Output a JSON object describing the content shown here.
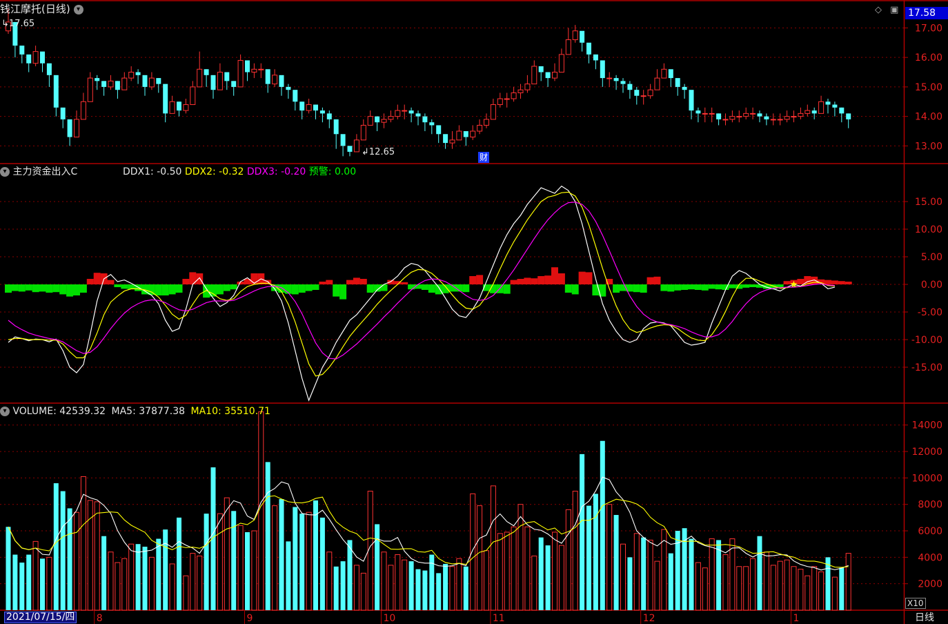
{
  "title": "钱江摩托(日线)",
  "current_price": "17.58",
  "period_label": "日线",
  "date_label": "2021/07/15/四",
  "x10_label": "X10",
  "financial_marker": "财",
  "price_high_label": "17.65",
  "price_low_label": "12.65",
  "indicator": {
    "name": "主力资金出入C",
    "ddx1_label": "DDX1:",
    "ddx1_value": "-0.50",
    "ddx2_label": "DDX2:",
    "ddx2_value": "-0.32",
    "ddx3_label": "DDX3:",
    "ddx3_value": "-0.20",
    "warn_label": "预警:",
    "warn_value": "0.00"
  },
  "volume_panel": {
    "volume_label": "VOLUME:",
    "volume_value": "42539.32",
    "ma5_label": "MA5:",
    "ma5_value": "37877.38",
    "ma10_label": "MA10:",
    "ma10_value": "35510.71"
  },
  "colors": {
    "up": "#ff3232",
    "down": "#54ffff",
    "ddx1": "#ffffff",
    "ddx2": "#ffff00",
    "ddx3": "#ff00ff",
    "grid": "#8b0000"
  },
  "chart_data": [
    {
      "type": "candlestick",
      "title": "钱江摩托(日线)",
      "y_ticks": [
        13.0,
        14.0,
        15.0,
        16.0,
        17.0
      ],
      "y_tick_labels": [
        "13.00",
        "14.00",
        "15.00",
        "16.00",
        "17.00"
      ],
      "ylim": [
        12.4,
        17.9
      ],
      "x_ticks": [
        {
          "label": "8",
          "index": 13
        },
        {
          "label": "9",
          "index": 35
        },
        {
          "label": "10",
          "index": 55
        },
        {
          "label": "11",
          "index": 71
        },
        {
          "label": "12",
          "index": 93
        },
        {
          "label": "1",
          "index": 115
        }
      ],
      "annotations": [
        {
          "text": "17.65",
          "index": 0
        },
        {
          "text": "12.65",
          "index": 53
        },
        {
          "text": "财",
          "index": 70
        }
      ],
      "close": [
        17.2,
        16.4,
        16.1,
        15.8,
        16.2,
        15.8,
        15.4,
        14.3,
        13.9,
        13.3,
        13.9,
        14.5,
        15.3,
        15.2,
        15.0,
        15.2,
        14.9,
        15.3,
        15.5,
        15.4,
        15.0,
        15.3,
        15.1,
        14.1,
        14.5,
        14.2,
        14.4,
        15.0,
        15.6,
        15.4,
        14.9,
        15.5,
        15.2,
        15.0,
        15.9,
        15.5,
        15.6,
        15.6,
        15.1,
        15.4,
        15.0,
        14.9,
        14.5,
        14.2,
        14.4,
        14.2,
        14.1,
        13.9,
        13.4,
        13.0,
        12.8,
        13.2,
        13.7,
        14.0,
        13.8,
        13.9,
        14.0,
        14.2,
        14.2,
        14.1,
        14.0,
        13.8,
        13.7,
        13.4,
        13.1,
        13.2,
        13.5,
        13.3,
        13.5,
        13.7,
        13.9,
        14.4,
        14.6,
        14.6,
        14.8,
        14.9,
        15.1,
        15.7,
        15.5,
        15.3,
        15.5,
        16.1,
        16.6,
        16.9,
        16.5,
        16.1,
        15.9,
        15.3,
        15.3,
        15.2,
        15.1,
        14.9,
        14.7,
        14.7,
        14.9,
        15.3,
        15.6,
        15.3,
        15.0,
        14.9,
        14.2,
        14.1,
        14.1,
        14.1,
        13.9,
        13.9,
        14.0,
        14.0,
        14.1,
        14.1,
        14.0,
        13.9,
        13.9,
        13.9,
        14.0,
        14.0,
        14.1,
        14.2,
        14.1,
        14.5,
        14.4,
        14.3,
        14.1,
        13.9
      ],
      "high": [
        17.65,
        16.6,
        16.3,
        16.0,
        16.4,
        16.0,
        15.6,
        14.6,
        14.2,
        13.6,
        14.2,
        14.8,
        15.5,
        15.4,
        15.2,
        15.4,
        15.2,
        15.5,
        15.7,
        15.6,
        15.2,
        15.5,
        15.3,
        14.4,
        14.7,
        14.5,
        14.6,
        15.2,
        16.2,
        15.6,
        15.1,
        15.8,
        15.4,
        15.2,
        16.1,
        15.8,
        15.8,
        15.8,
        15.3,
        15.6,
        15.2,
        15.1,
        14.8,
        14.5,
        14.6,
        14.4,
        14.3,
        14.2,
        13.7,
        13.2,
        13.0,
        13.4,
        13.9,
        14.2,
        14.0,
        14.1,
        14.2,
        14.4,
        14.4,
        14.3,
        14.2,
        14.1,
        13.9,
        13.7,
        13.3,
        13.5,
        13.7,
        13.5,
        13.7,
        13.9,
        14.1,
        14.6,
        14.8,
        14.8,
        15.0,
        15.1,
        15.4,
        15.9,
        15.7,
        15.5,
        15.8,
        16.3,
        17.0,
        17.1,
        16.7,
        16.4,
        16.1,
        15.6,
        15.5,
        15.4,
        15.3,
        15.2,
        15.0,
        14.9,
        15.1,
        15.6,
        15.8,
        15.5,
        15.2,
        15.1,
        14.5,
        14.3,
        14.3,
        14.3,
        14.1,
        14.1,
        14.2,
        14.2,
        14.3,
        14.3,
        14.2,
        14.1,
        14.1,
        14.1,
        14.2,
        14.2,
        14.3,
        14.4,
        14.3,
        14.7,
        14.6,
        14.5,
        14.3,
        14.1
      ],
      "low": [
        16.8,
        16.0,
        15.8,
        15.5,
        15.7,
        15.5,
        15.0,
        14.0,
        13.6,
        13.0,
        13.5,
        14.1,
        14.9,
        14.9,
        14.7,
        14.9,
        14.6,
        14.9,
        15.2,
        15.1,
        14.7,
        14.9,
        14.8,
        13.8,
        14.1,
        14.0,
        14.1,
        14.6,
        15.1,
        15.0,
        14.6,
        15.1,
        14.9,
        14.7,
        15.4,
        15.2,
        15.3,
        15.3,
        14.8,
        15.0,
        14.7,
        14.6,
        14.2,
        13.9,
        14.1,
        13.9,
        13.8,
        13.6,
        12.9,
        12.65,
        12.65,
        12.9,
        13.4,
        13.7,
        13.5,
        13.6,
        13.8,
        13.9,
        13.9,
        13.8,
        13.7,
        13.5,
        13.4,
        13.1,
        12.9,
        12.9,
        13.2,
        13.0,
        13.2,
        13.4,
        13.6,
        14.1,
        14.3,
        14.3,
        14.5,
        14.6,
        14.8,
        15.3,
        15.2,
        15.0,
        15.2,
        15.7,
        16.2,
        16.5,
        16.2,
        15.8,
        15.6,
        15.0,
        15.0,
        14.9,
        14.8,
        14.6,
        14.4,
        14.4,
        14.6,
        15.0,
        15.3,
        15.0,
        14.7,
        14.6,
        13.9,
        13.8,
        13.8,
        13.8,
        13.7,
        13.7,
        13.8,
        13.8,
        13.9,
        13.9,
        13.8,
        13.7,
        13.7,
        13.7,
        13.8,
        13.8,
        13.9,
        14.0,
        13.9,
        14.2,
        14.1,
        14.0,
        13.8,
        13.6
      ]
    },
    {
      "type": "line",
      "title": "主力资金出入C",
      "y_ticks": [
        -15,
        -10,
        -5,
        0,
        5,
        10,
        15
      ],
      "y_tick_labels": [
        "-15.00",
        "-10.00",
        "-5.00",
        "0.00",
        "5.00",
        "10.00",
        "15.00"
      ],
      "ylim": [
        -21.5,
        21.5
      ],
      "series": [
        {
          "name": "DDX1",
          "values": [
            -10.5,
            -9.5,
            -9.8,
            -10.2,
            -9.9,
            -10.0,
            -10.4,
            -9.9,
            -12.0,
            -15.0,
            -16.0,
            -14.5,
            -9.0,
            -3.0,
            1.0,
            1.8,
            0.5,
            0.8,
            0.2,
            -0.5,
            -1.2,
            -2.0,
            -3.5,
            -6.5,
            -8.5,
            -8.0,
            -4.5,
            0.0,
            1.2,
            -0.8,
            -2.5,
            -4.0,
            -3.3,
            -2.0,
            0.5,
            1.2,
            0.2,
            1.0,
            0.5,
            -0.8,
            -3.0,
            -7.0,
            -12.0,
            -17.0,
            -21.0,
            -18.0,
            -15.0,
            -13.0,
            -10.5,
            -8.5,
            -6.5,
            -5.5,
            -4.0,
            -2.5,
            -1.0,
            0.0,
            0.5,
            1.5,
            3.0,
            3.8,
            3.5,
            2.5,
            1.0,
            -0.5,
            -2.5,
            -4.5,
            -5.7,
            -6.0,
            -4.5,
            -2.5,
            0.5,
            3.5,
            6.5,
            9.0,
            11.0,
            12.5,
            14.5,
            16.0,
            17.5,
            17.0,
            16.5,
            17.8,
            17.0,
            15.0,
            11.0,
            6.0,
            1.0,
            -3.5,
            -6.5,
            -8.5,
            -10.0,
            -10.5,
            -10.0,
            -8.0,
            -7.0,
            -6.8,
            -7.0,
            -7.5,
            -9.0,
            -10.5,
            -11.0,
            -10.8,
            -10.5,
            -7.0,
            -4.0,
            -1.0,
            1.5,
            2.5,
            2.0,
            1.0,
            0.0,
            -0.5,
            -0.8,
            -1.2,
            -0.5,
            0.0,
            -0.3,
            0.5,
            0.8,
            0.2,
            -0.8,
            -0.5
          ],
          "color": "#ffffff"
        },
        {
          "name": "DDX2",
          "values": [
            -10.0,
            -9.8,
            -9.8,
            -10.0,
            -10.0,
            -10.0,
            -10.1,
            -10.1,
            -10.8,
            -12.2,
            -13.3,
            -13.3,
            -11.7,
            -8.8,
            -5.5,
            -3.2,
            -2.1,
            -1.2,
            -0.8,
            -0.8,
            -1.0,
            -1.4,
            -2.3,
            -3.8,
            -5.4,
            -6.3,
            -5.6,
            -3.6,
            -1.8,
            -1.1,
            -1.7,
            -2.6,
            -2.9,
            -2.6,
            -1.3,
            -0.4,
            0.0,
            0.2,
            0.2,
            -0.2,
            -1.3,
            -3.6,
            -6.8,
            -10.6,
            -14.4,
            -16.6,
            -16.3,
            -15.0,
            -13.3,
            -11.3,
            -9.4,
            -7.9,
            -6.5,
            -5.1,
            -3.6,
            -2.3,
            -1.1,
            0.0,
            1.2,
            2.2,
            2.7,
            2.6,
            2.0,
            0.9,
            -0.4,
            -1.9,
            -3.3,
            -4.3,
            -4.5,
            -3.8,
            -2.2,
            0.1,
            2.8,
            5.4,
            7.7,
            9.7,
            11.7,
            13.4,
            15.0,
            15.8,
            16.1,
            16.6,
            16.7,
            16.0,
            14.0,
            10.8,
            6.9,
            2.9,
            -0.8,
            -3.9,
            -6.4,
            -8.1,
            -8.7,
            -8.4,
            -7.9,
            -7.5,
            -7.3,
            -7.4,
            -8.0,
            -8.9,
            -9.7,
            -10.1,
            -10.2,
            -9.1,
            -7.3,
            -4.9,
            -2.2,
            0.0,
            1.1,
            1.1,
            0.6,
            0.1,
            -0.3,
            -0.7,
            -0.6,
            -0.4,
            -0.4,
            0.1,
            0.4,
            0.3,
            -0.2,
            -0.3
          ],
          "color": "#ffff00"
        },
        {
          "name": "DDX3",
          "values": [
            -6.5,
            -7.5,
            -8.2,
            -8.8,
            -9.2,
            -9.5,
            -9.8,
            -10.0,
            -10.4,
            -11.2,
            -12.0,
            -12.5,
            -12.3,
            -11.3,
            -9.7,
            -8.0,
            -6.5,
            -5.2,
            -4.2,
            -3.5,
            -3.0,
            -2.8,
            -2.9,
            -3.3,
            -4.0,
            -4.6,
            -4.8,
            -4.5,
            -3.9,
            -3.3,
            -3.0,
            -3.0,
            -3.0,
            -2.9,
            -2.4,
            -1.8,
            -1.2,
            -0.7,
            -0.4,
            -0.3,
            -0.6,
            -1.5,
            -3.1,
            -5.3,
            -8.0,
            -10.6,
            -12.4,
            -13.4,
            -13.5,
            -12.8,
            -11.8,
            -10.8,
            -9.6,
            -8.4,
            -7.2,
            -5.9,
            -4.7,
            -3.4,
            -2.2,
            -1.0,
            0.0,
            0.7,
            1.0,
            0.9,
            0.5,
            -0.2,
            -1.1,
            -2.0,
            -2.7,
            -2.9,
            -2.7,
            -2.0,
            -0.7,
            0.9,
            2.6,
            4.5,
            6.4,
            8.3,
            10.1,
            11.7,
            13.0,
            14.1,
            14.8,
            14.9,
            14.5,
            13.3,
            11.4,
            8.9,
            6.1,
            3.2,
            0.4,
            -2.1,
            -4.0,
            -5.4,
            -6.3,
            -6.8,
            -7.1,
            -7.3,
            -7.6,
            -8.0,
            -8.6,
            -9.1,
            -9.5,
            -9.5,
            -9.1,
            -8.1,
            -6.7,
            -5.0,
            -3.5,
            -2.3,
            -1.5,
            -1.0,
            -0.7,
            -0.6,
            -0.5,
            -0.5,
            -0.4,
            -0.2,
            0.0,
            0.1,
            -0.1,
            -0.2
          ],
          "color": "#ff00ff"
        }
      ],
      "bars": [
        -1.5,
        -1.2,
        -1.3,
        -1.1,
        -1.4,
        -1.3,
        -1.5,
        -1.4,
        -1.8,
        -2.2,
        -2.0,
        -1.5,
        1.0,
        2.1,
        2.0,
        0.8,
        -0.5,
        -0.8,
        -0.9,
        -1.2,
        -1.8,
        -1.9,
        -2.0,
        -2.0,
        -1.8,
        -1.5,
        1.0,
        2.2,
        2.0,
        -2.4,
        -2.2,
        -1.8,
        -1.2,
        -0.9,
        0.5,
        1.0,
        2.0,
        2.0,
        0.8,
        -1.2,
        -1.5,
        -1.7,
        -1.8,
        -1.5,
        -1.2,
        -1.0,
        0.5,
        0.8,
        -2.2,
        -2.7,
        0.8,
        1.2,
        1.0,
        -1.5,
        -1.3,
        -1.2,
        0.8,
        0.6,
        0.4,
        -0.9,
        -0.8,
        -1.0,
        -1.5,
        -1.8,
        -1.6,
        -1.3,
        -1.3,
        -1.4,
        1.5,
        1.7,
        -1.2,
        -1.6,
        -1.6,
        -1.7,
        0.8,
        1.0,
        1.2,
        1.1,
        1.5,
        1.6,
        3.1,
        2.0,
        -1.5,
        -1.8,
        2.3,
        2.2,
        -2.0,
        -2.2,
        1.0,
        -1.5,
        -1.2,
        -1.3,
        -1.4,
        -1.5,
        1.3,
        1.4,
        -1.2,
        -1.3,
        -1.1,
        -1.0,
        -0.9,
        -1.0,
        -1.1,
        -0.8,
        -0.9,
        -1.0,
        -0.7,
        -0.8,
        -0.6,
        -0.5,
        -0.6,
        -0.8,
        -0.9,
        -0.7,
        0.6,
        0.8,
        1.0,
        1.5,
        1.4,
        0.9,
        0.8,
        0.7,
        0.6,
        0.5
      ],
      "marker": {
        "type": "star",
        "index": 115
      }
    },
    {
      "type": "bar",
      "title": "VOLUME",
      "y_ticks": [
        2000,
        4000,
        6000,
        8000,
        10000,
        12000,
        14000
      ],
      "y_tick_labels": [
        "2000",
        "4000",
        "6000",
        "8000",
        "10000",
        "12000",
        "14000"
      ],
      "ylim": [
        0,
        15500
      ],
      "values": [
        6300,
        4200,
        3600,
        4200,
        5200,
        3900,
        4000,
        9600,
        9000,
        7700,
        7400,
        10100,
        8300,
        8200,
        5600,
        4400,
        3600,
        3900,
        5000,
        5000,
        4800,
        4000,
        5400,
        6100,
        3500,
        7000,
        2600,
        4300,
        4100,
        7300,
        10800,
        7300,
        8500,
        7500,
        6400,
        5900,
        6000,
        15000,
        11200,
        7900,
        8400,
        5200,
        7800,
        7300,
        7400,
        8300,
        7000,
        4400,
        3300,
        3700,
        5300,
        3400,
        2800,
        9000,
        6500,
        4400,
        3400,
        4200,
        3800,
        3700,
        3100,
        3000,
        4200,
        2800,
        3500,
        3300,
        3900,
        3300,
        8800,
        7900,
        4500,
        9400,
        5800,
        5900,
        6300,
        8000,
        6300,
        4100,
        5500,
        4900,
        5900,
        4900,
        7600,
        9000,
        11800,
        7900,
        8800,
        12800,
        8000,
        7200,
        5000,
        4000,
        5800,
        5500,
        5300,
        3700,
        6100,
        4300,
        6000,
        6200,
        5400,
        3600,
        3200,
        5400,
        5300,
        4200,
        5400,
        3300,
        3300,
        3900,
        5600,
        4400,
        3400,
        3700,
        3800,
        3300,
        3100,
        2600,
        3300,
        2900,
        4000,
        2500,
        3200,
        4300
      ],
      "up": [
        0,
        0,
        0,
        0,
        1,
        0,
        1,
        0,
        0,
        0,
        1,
        1,
        1,
        1,
        0,
        1,
        1,
        1,
        1,
        0,
        0,
        1,
        0,
        0,
        1,
        0,
        1,
        1,
        1,
        0,
        0,
        1,
        1,
        0,
        1,
        0,
        1,
        1,
        0,
        1,
        0,
        0,
        0,
        0,
        1,
        0,
        0,
        1,
        0,
        0,
        0,
        1,
        1,
        1,
        0,
        1,
        1,
        1,
        1,
        0,
        0,
        0,
        0,
        0,
        0,
        1,
        1,
        0,
        1,
        1,
        1,
        1,
        1,
        1,
        1,
        1,
        1,
        1,
        0,
        0,
        1,
        1,
        1,
        1,
        0,
        0,
        0,
        0,
        1,
        0,
        1,
        0,
        1,
        0,
        1,
        1,
        1,
        0,
        0,
        0,
        0,
        1,
        1,
        1,
        0,
        1,
        1,
        1,
        1,
        1,
        0,
        1,
        1,
        1,
        1,
        1,
        1,
        1,
        1,
        1,
        0,
        1,
        0,
        1
      ],
      "series": [
        {
          "name": "MA5",
          "color": "#ffffff"
        },
        {
          "name": "MA10",
          "color": "#ffff00"
        }
      ]
    }
  ]
}
